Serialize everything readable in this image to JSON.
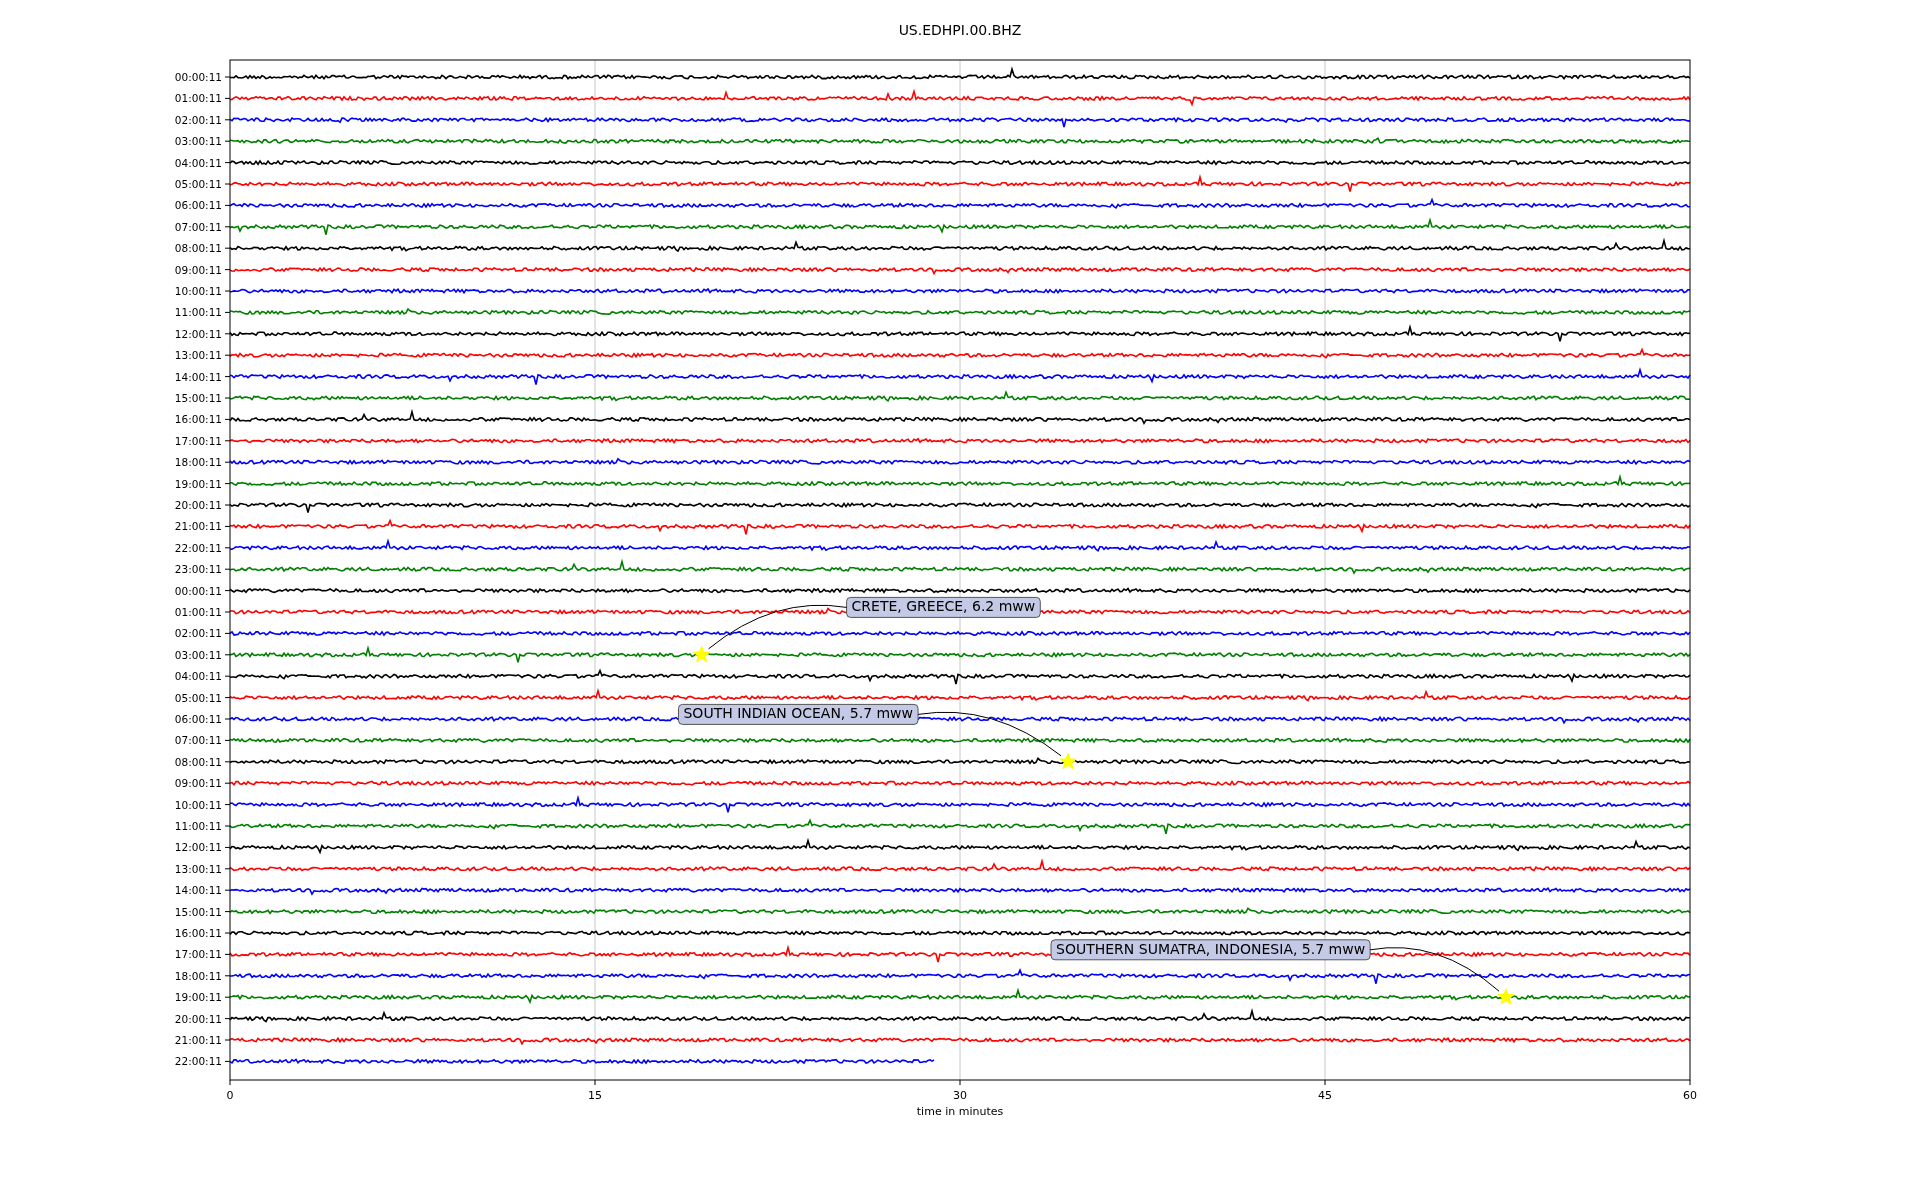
{
  "title": "US.EDHPI.00.BHZ",
  "xlabel": "time in minutes",
  "xticks": [
    "0",
    "15",
    "30",
    "45",
    "60"
  ],
  "rows": [
    {
      "label": "00:00:11",
      "color": "#000000",
      "level": 1
    },
    {
      "label": "01:00:11",
      "color": "#ff0000",
      "level": 1
    },
    {
      "label": "02:00:11",
      "color": "#0000ff",
      "level": 1
    },
    {
      "label": "03:00:11",
      "color": "#008000",
      "level": 1
    },
    {
      "label": "04:00:11",
      "color": "#000000",
      "level": 1
    },
    {
      "label": "05:00:11",
      "color": "#ff0000",
      "level": 1
    },
    {
      "label": "06:00:11",
      "color": "#0000ff",
      "level": 1
    },
    {
      "label": "07:00:11",
      "color": "#008000",
      "level": 1
    },
    {
      "label": "08:00:11",
      "color": "#000000",
      "level": 1
    },
    {
      "label": "09:00:11",
      "color": "#ff0000",
      "level": 1
    },
    {
      "label": "10:00:11",
      "color": "#0000ff",
      "level": 1
    },
    {
      "label": "11:00:11",
      "color": "#008000",
      "level": 1
    },
    {
      "label": "12:00:11",
      "color": "#000000",
      "level": 1
    },
    {
      "label": "13:00:11",
      "color": "#ff0000",
      "level": 1
    },
    {
      "label": "14:00:11",
      "color": "#0000ff",
      "level": 1
    },
    {
      "label": "15:00:11",
      "color": "#008000",
      "level": 1
    },
    {
      "label": "16:00:11",
      "color": "#000000",
      "level": 1
    },
    {
      "label": "17:00:11",
      "color": "#ff0000",
      "level": 1
    },
    {
      "label": "18:00:11",
      "color": "#0000ff",
      "level": 1
    },
    {
      "label": "19:00:11",
      "color": "#008000",
      "level": 1
    },
    {
      "label": "20:00:11",
      "color": "#000000",
      "level": 1
    },
    {
      "label": "21:00:11",
      "color": "#ff0000",
      "level": 1
    },
    {
      "label": "22:00:11",
      "color": "#0000ff",
      "level": 1
    },
    {
      "label": "23:00:11",
      "color": "#008000",
      "level": 1
    },
    {
      "label": "00:00:11",
      "color": "#000000",
      "level": 1
    },
    {
      "label": "01:00:11",
      "color": "#ff0000",
      "level": 1
    },
    {
      "label": "02:00:11",
      "color": "#0000ff",
      "level": 1
    },
    {
      "label": "03:00:11",
      "color": "#008000",
      "level": 1,
      "event": {
        "label": "CRETE, GREECE, 6.2 mww",
        "level": 0.323
      }
    },
    {
      "label": "04:00:11",
      "color": "#000000",
      "level": 1
    },
    {
      "label": "05:00:11",
      "color": "#ff0000",
      "level": 1
    },
    {
      "label": "06:00:11",
      "color": "#0000ff",
      "level": 1
    },
    {
      "label": "07:00:11",
      "color": "#008000",
      "level": 1
    },
    {
      "label": "08:00:11",
      "color": "#000000",
      "level": 1,
      "event": {
        "label": "SOUTH INDIAN OCEAN, 5.7 mww",
        "level": 0.574
      }
    },
    {
      "label": "09:00:11",
      "color": "#ff0000",
      "level": 1
    },
    {
      "label": "10:00:11",
      "color": "#0000ff",
      "level": 1
    },
    {
      "label": "11:00:11",
      "color": "#008000",
      "level": 1
    },
    {
      "label": "12:00:11",
      "color": "#000000",
      "level": 1
    },
    {
      "label": "13:00:11",
      "color": "#ff0000",
      "level": 1
    },
    {
      "label": "14:00:11",
      "color": "#0000ff",
      "level": 1
    },
    {
      "label": "15:00:11",
      "color": "#008000",
      "level": 1
    },
    {
      "label": "16:00:11",
      "color": "#000000",
      "level": 1
    },
    {
      "label": "17:00:11",
      "color": "#ff0000",
      "level": 1
    },
    {
      "label": "18:00:11",
      "color": "#0000ff",
      "level": 1
    },
    {
      "label": "19:00:11",
      "color": "#008000",
      "level": 1,
      "event": {
        "label": "SOUTHERN SUMATRA, INDONESIA, 5.7 mww",
        "level": 0.874
      }
    },
    {
      "label": "20:00:11",
      "color": "#000000",
      "level": 1
    },
    {
      "label": "21:00:11",
      "color": "#ff0000",
      "level": 1
    },
    {
      "label": "22:00:11",
      "color": "#0000ff",
      "level": 0.483
    }
  ]
}
